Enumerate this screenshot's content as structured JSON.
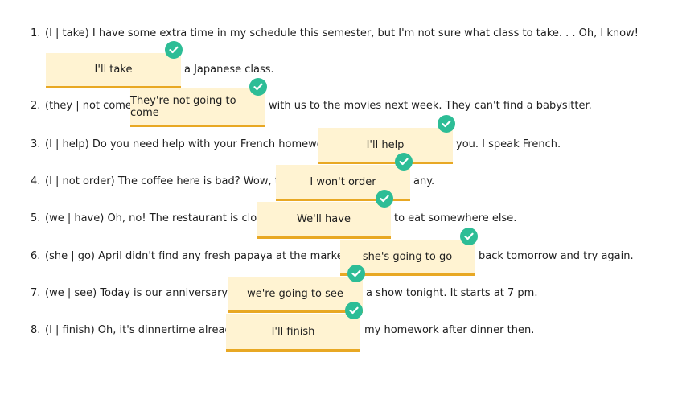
{
  "colors": {
    "blank_fill": "#fff3d2",
    "blank_underline": "#e8a824",
    "check_badge": "#2dbd96"
  },
  "icons": {
    "correct": "checkmark-icon"
  },
  "questions": [
    {
      "number": "1.",
      "before": "(I | take) I have some extra time in my schedule this semester, but I'm not sure what class to take. . . Oh, I know!",
      "answer": "I'll take",
      "after": "a Japanese class.",
      "status": "correct"
    },
    {
      "number": "2.",
      "before": "(they | not come)",
      "answer": "They're not going to come",
      "after": "with us to the movies next week. They can't find a babysitter.",
      "status": "correct"
    },
    {
      "number": "3.",
      "before": "(I | help) Do you need help with your French homework?",
      "answer": "I'll help",
      "after": "you. I speak French.",
      "status": "correct"
    },
    {
      "number": "4.",
      "before": "(I | not order) The coffee here is bad? Wow, then",
      "answer": "I won't order",
      "after": "any.",
      "status": "correct"
    },
    {
      "number": "5.",
      "before": "(we | have) Oh, no! The restaurant is closed.",
      "answer": "We'll have",
      "after": "to eat somewhere else.",
      "status": "correct"
    },
    {
      "number": "6.",
      "before": "(she | go) April didn't find any fresh papaya at the market, so",
      "answer": "she's going to go",
      "after": "back tomorrow and try again.",
      "status": "correct"
    },
    {
      "number": "7.",
      "before": "(we | see) Today is our anniversary, so",
      "answer": "we're going to see",
      "after": "a show tonight. It starts at 7 pm.",
      "status": "correct"
    },
    {
      "number": "8.",
      "before": "(I | finish) Oh, it's dinnertime already?",
      "answer": "I'll finish",
      "after": "my homework after dinner then.",
      "status": "correct"
    }
  ]
}
